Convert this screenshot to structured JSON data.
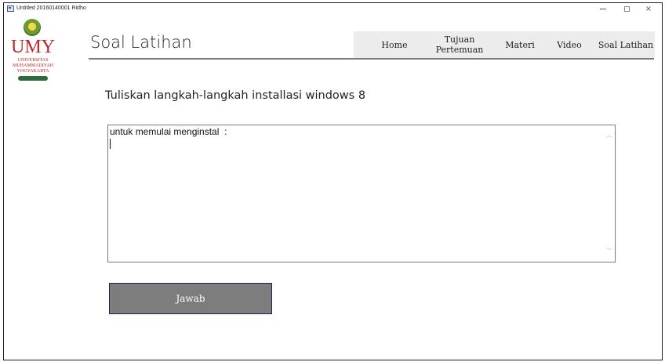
{
  "window": {
    "title": "Untitled 20160140001 Ridho",
    "controls": {
      "minimize": "–",
      "maximize": "□",
      "close": "×"
    }
  },
  "logo": {
    "mark": "UMY",
    "line1": "UNIVERSITAS",
    "line2": "MUHAMMADIYAH",
    "line3": "YOGYAKARTA",
    "color": "#c0262c"
  },
  "header": {
    "title": "Soal Latihan",
    "nav": [
      {
        "label": "Home"
      },
      {
        "label_line1": "Tujuan",
        "label_line2": "Pertemuan"
      },
      {
        "label": "Materi"
      },
      {
        "label": "Video"
      },
      {
        "label": "Soal Latihan"
      }
    ]
  },
  "main": {
    "question": "Tuliskan langkah-langkah installasi windows 8",
    "answer_value": "untuk memulai menginstal  :",
    "submit_label": "Jawab"
  },
  "colors": {
    "nav_bg": "#ececec",
    "button_bg": "#7d7d7d",
    "button_border": "#1d1f5a"
  }
}
